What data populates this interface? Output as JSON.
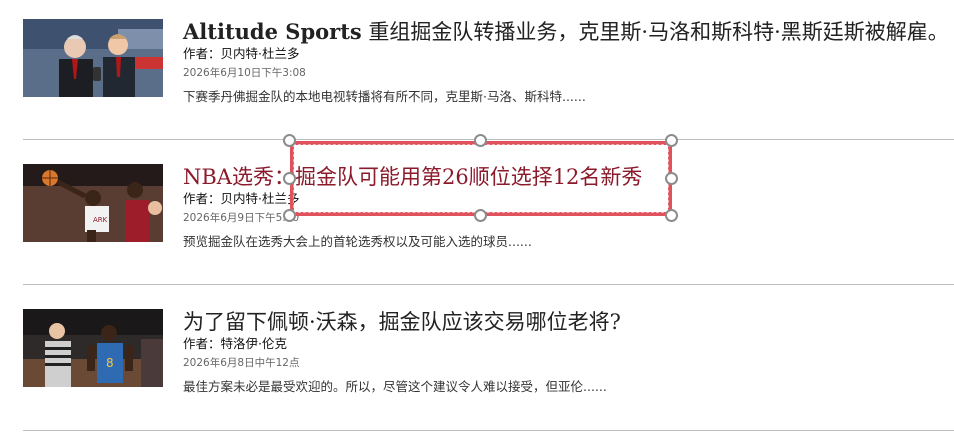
{
  "articles": [
    {
      "title_bold": "Altitude Sports",
      "title_rest": " 重组掘金队转播业务，克里斯·马洛和斯科特·黑斯廷斯被解雇。",
      "author": "作者：贝内特·杜兰多",
      "date": "2026年6月10日下午3:08",
      "excerpt": "下赛季丹佛掘金队的本地电视转播将有所不同，克里斯·马洛、斯科特......"
    },
    {
      "title": "NBA选秀：掘金队可能用第26顺位选择12名新秀",
      "author": "作者：贝内特·杜兰多",
      "date": "2026年6月9日下午5:00",
      "excerpt": "预览掘金队在选秀大会上的首轮选秀权以及可能入选的球员......"
    },
    {
      "title": "为了留下佩顿·沃森，掘金队应该交易哪位老将?",
      "author": "作者：特洛伊·伦克",
      "date": "2026年6月8日中午12点",
      "excerpt": "最佳方案未必是最受欢迎的。所以，尽管这个建议令人难以接受，但亚伦......"
    }
  ],
  "colors": {
    "active_title": "#8b1a2b",
    "selection_border": "#e0525c",
    "divider": "#bdbdbd"
  }
}
